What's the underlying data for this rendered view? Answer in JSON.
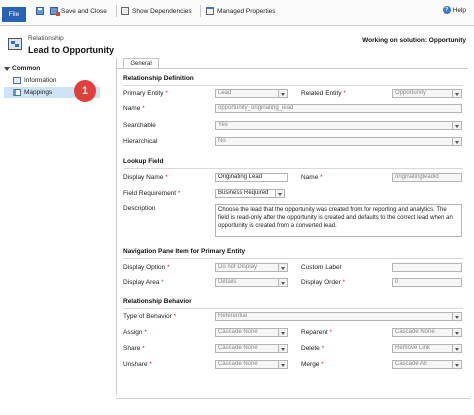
{
  "toolbar": {
    "file_label": "File",
    "save_close_label": "Save and Close",
    "show_dependencies_label": "Show Dependencies",
    "managed_properties_label": "Managed Properties",
    "help_label": "Help"
  },
  "header": {
    "kind": "Relationship",
    "name": "Lead to Opportunity",
    "solution": "Working on solution: Opportunity"
  },
  "nav": {
    "group_label": "Common",
    "items": [
      {
        "label": "Information"
      },
      {
        "label": "Mappings"
      }
    ],
    "badge_number": "1"
  },
  "tabs": [
    {
      "label": "General"
    }
  ],
  "relationship_definition": {
    "title": "Relationship Definition",
    "primary_entity_label": "Primary Entity",
    "primary_entity_value": "Lead",
    "related_entity_label": "Related Entity",
    "related_entity_value": "Opportunity",
    "name_label": "Name",
    "name_value": "opportunity_originating_lead",
    "searchable_label": "Searchable",
    "searchable_value": "Yes",
    "hierarchical_label": "Hierarchical",
    "hierarchical_value": "No"
  },
  "lookup_field": {
    "title": "Lookup Field",
    "display_name_label": "Display Name",
    "display_name_value": "Originating Lead",
    "name_label": "Name",
    "name_value": "originatingleadid",
    "field_requirement_label": "Field Requirement",
    "field_requirement_value": "Business Required",
    "description_label": "Description",
    "description_value": "Choose the lead that the opportunity was created from for reporting and analytics. The field is read-only after the opportunity is created and defaults to the correct lead when an opportunity is created from a converted lead."
  },
  "navigation_pane": {
    "title": "Navigation Pane Item for Primary Entity",
    "display_option_label": "Display Option",
    "display_option_value": "Do not Display",
    "custom_label_label": "Custom Label",
    "custom_label_value": "",
    "display_area_label": "Display Area",
    "display_area_value": "Details",
    "display_order_label": "Display Order",
    "display_order_value": "0"
  },
  "relationship_behavior": {
    "title": "Relationship Behavior",
    "type_label": "Type of Behavior",
    "type_value": "Referential",
    "assign_label": "Assign",
    "assign_value": "Cascade None",
    "reparent_label": "Reparent",
    "reparent_value": "Cascade None",
    "share_label": "Share",
    "share_value": "Cascade None",
    "delete_label": "Delete",
    "delete_value": "Remove Link",
    "unshare_label": "Unshare",
    "unshare_value": "Cascade None",
    "merge_label": "Merge",
    "merge_value": "Cascade All"
  },
  "colors": {
    "accent": "#2a63b6",
    "selected_nav": "#cfe3f7",
    "required": "#d02020",
    "badge": "#e23f3a"
  }
}
